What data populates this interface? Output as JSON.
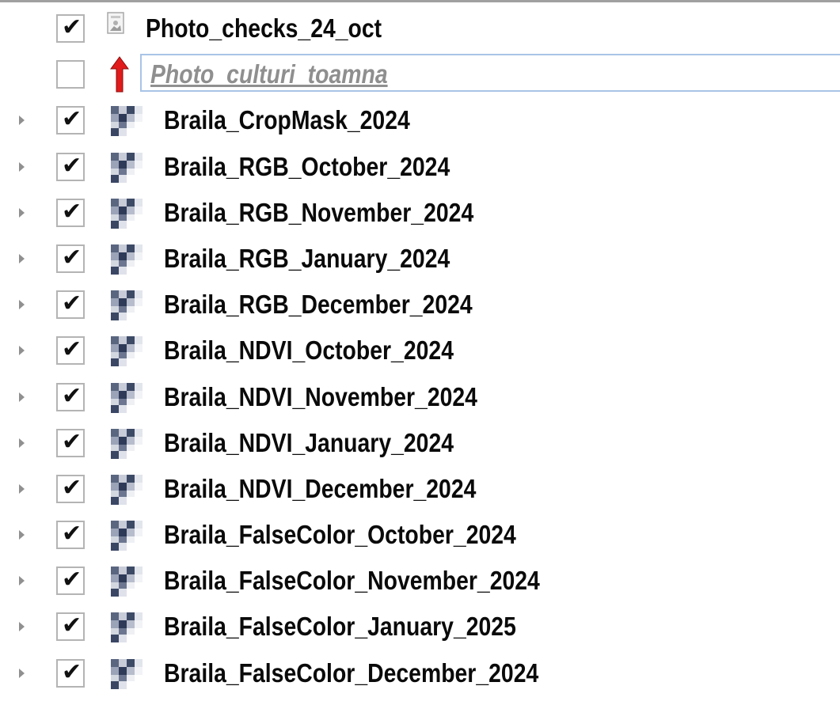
{
  "layers": [
    {
      "name": "Photo_checks_24_oct",
      "checked": true,
      "icon": "photo-icon",
      "expandable": false,
      "state": "normal"
    },
    {
      "name": "Photo_culturi_toamna",
      "checked": false,
      "icon": "broken-link-arrow-icon",
      "expandable": false,
      "state": "missing-editing"
    },
    {
      "name": "Braila_CropMask_2024",
      "checked": true,
      "icon": "raster-icon",
      "expandable": true,
      "state": "normal"
    },
    {
      "name": "Braila_RGB_October_2024",
      "checked": true,
      "icon": "raster-icon",
      "expandable": true,
      "state": "normal"
    },
    {
      "name": "Braila_RGB_November_2024",
      "checked": true,
      "icon": "raster-icon",
      "expandable": true,
      "state": "normal"
    },
    {
      "name": "Braila_RGB_January_2024",
      "checked": true,
      "icon": "raster-icon",
      "expandable": true,
      "state": "normal"
    },
    {
      "name": "Braila_RGB_December_2024",
      "checked": true,
      "icon": "raster-icon",
      "expandable": true,
      "state": "normal"
    },
    {
      "name": "Braila_NDVI_October_2024",
      "checked": true,
      "icon": "raster-icon",
      "expandable": true,
      "state": "normal"
    },
    {
      "name": "Braila_NDVI_November_2024",
      "checked": true,
      "icon": "raster-icon",
      "expandable": true,
      "state": "normal"
    },
    {
      "name": "Braila_NDVI_January_2024",
      "checked": true,
      "icon": "raster-icon",
      "expandable": true,
      "state": "normal"
    },
    {
      "name": "Braila_NDVI_December_2024",
      "checked": true,
      "icon": "raster-icon",
      "expandable": true,
      "state": "normal"
    },
    {
      "name": "Braila_FalseColor_October_2024",
      "checked": true,
      "icon": "raster-icon",
      "expandable": true,
      "state": "normal"
    },
    {
      "name": "Braila_FalseColor_November_2024",
      "checked": true,
      "icon": "raster-icon",
      "expandable": true,
      "state": "normal"
    },
    {
      "name": "Braila_FalseColor_January_2025",
      "checked": true,
      "icon": "raster-icon",
      "expandable": true,
      "state": "normal"
    },
    {
      "name": "Braila_FalseColor_December_2024",
      "checked": true,
      "icon": "raster-icon",
      "expandable": true,
      "state": "normal"
    }
  ],
  "colors": {
    "check_border": "#b4b4b4",
    "expander": "#909090",
    "edit_border": "#a9c4e6",
    "missing_text": "#8f8f8f",
    "arrow_red": "#e11b1b"
  }
}
